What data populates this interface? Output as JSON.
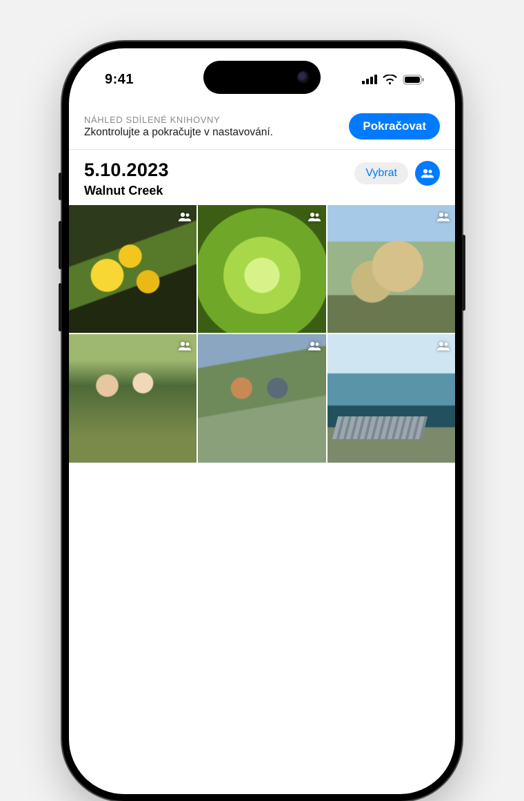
{
  "status": {
    "time": "9:41"
  },
  "banner": {
    "title": "NÁHLED SDÍLENÉ KNIHOVNY",
    "subtitle": "Zkontrolujte a pokračujte v nastavování.",
    "continue_label": "Pokračovat"
  },
  "header": {
    "date": "5.10.2023",
    "location": "Walnut Creek",
    "select_label": "Vybrat"
  },
  "icons": {
    "people": "people-icon",
    "shared_badge": "people-shared-badge"
  },
  "grid": {
    "rows": 2,
    "cols": 3,
    "items": [
      {
        "shared": true
      },
      {
        "shared": true
      },
      {
        "shared": true
      },
      {
        "shared": true
      },
      {
        "shared": true
      },
      {
        "shared": true
      }
    ]
  },
  "colors": {
    "accent": "#007aff",
    "pill_bg": "#eeeeef",
    "divider": "#e3e3e5"
  }
}
